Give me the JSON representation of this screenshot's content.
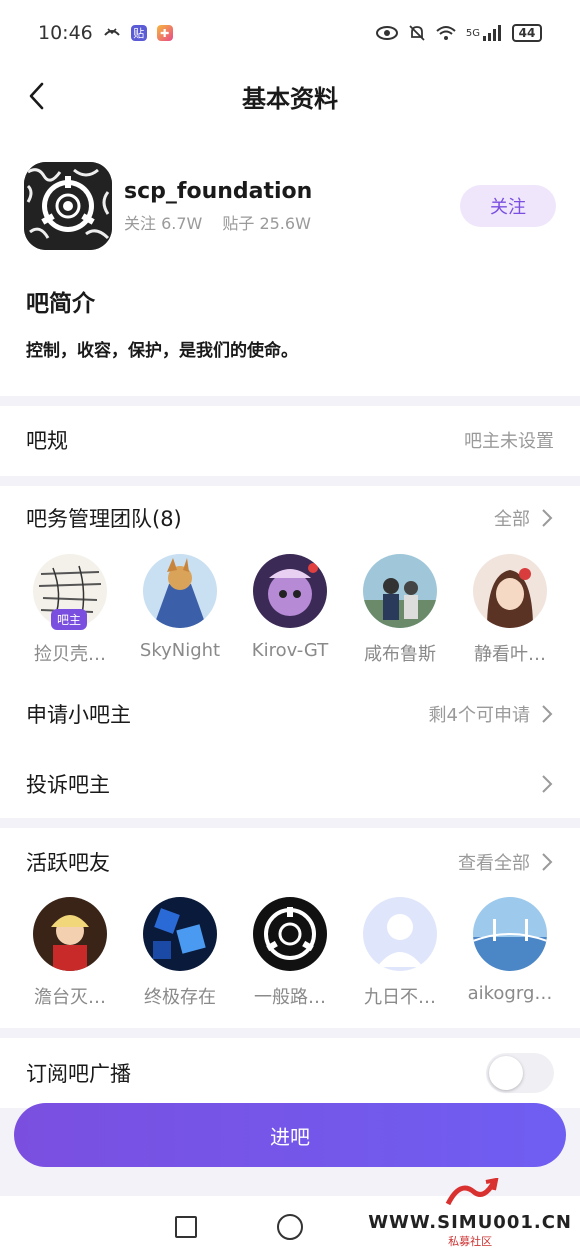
{
  "status_bar": {
    "time": "10:46",
    "network": "5G",
    "battery": "44"
  },
  "header": {
    "title": "基本资料"
  },
  "forum": {
    "name": "scp_foundation",
    "follow_label": "关注",
    "follow_stat": "关注 6.7W",
    "post_stat": "贴子 25.6W",
    "follow_button": "关注"
  },
  "intro": {
    "title": "吧简介",
    "text": "控制，收容，保护，是我们的使命。"
  },
  "rules": {
    "title": "吧规",
    "value": "吧主未设置"
  },
  "team": {
    "title": "吧务管理团队(8)",
    "all_label": "全部",
    "owner_badge": "吧主",
    "members": [
      {
        "name": "捡贝壳…"
      },
      {
        "name": "SkyNight"
      },
      {
        "name": "Kirov-GT"
      },
      {
        "name": "咸布鲁斯"
      },
      {
        "name": "静看叶…"
      }
    ]
  },
  "apply": {
    "title": "申请小吧主",
    "value": "剩4个可申请"
  },
  "complain": {
    "title": "投诉吧主"
  },
  "active": {
    "title": "活跃吧友",
    "all_label": "查看全部",
    "members": [
      {
        "name": "澹台灭…"
      },
      {
        "name": "终极存在"
      },
      {
        "name": "一般路…"
      },
      {
        "name": "九日不…"
      },
      {
        "name": "aikogrg…"
      }
    ]
  },
  "subscribe": {
    "title": "订阅吧广播",
    "enabled": false
  },
  "enter_button": "进吧",
  "watermark": {
    "text": "WWW.SIMU001.CN",
    "sub": "私募社区"
  },
  "colors": {
    "accent": "#7a4fe0",
    "follow_bg": "#efe6fb",
    "divider": "#f3f2f8"
  }
}
